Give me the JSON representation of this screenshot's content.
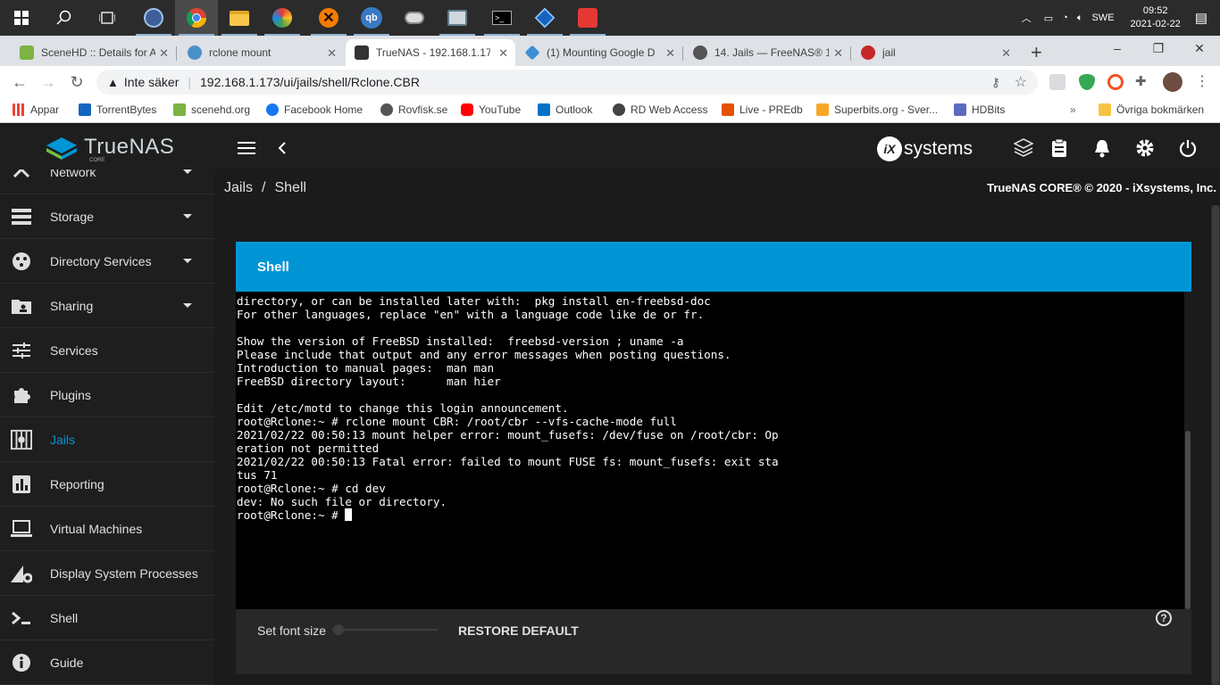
{
  "taskbar": {
    "language": "SWE",
    "time": "09:52",
    "date": "2021-02-22",
    "icons": [
      "windows-start-icon",
      "search-icon",
      "task-view-icon",
      "app-icon",
      "chrome-icon",
      "file-explorer-icon",
      "app-icon",
      "app-icon",
      "qbittorrent-icon",
      "app-icon",
      "app-icon",
      "terminal-icon",
      "app-icon",
      "app-icon"
    ]
  },
  "tabs": [
    {
      "title": "SceneHD :: Details for A",
      "color": "#7cb342"
    },
    {
      "title": "rclone mount",
      "color": "#4a90c8"
    },
    {
      "title": "TrueNAS - 192.168.1.17",
      "color": "#333333"
    },
    {
      "title": "(1) Mounting Google D",
      "color": "#3d8fd6"
    },
    {
      "title": "14. Jails — FreeNAS® 1",
      "color": "#555555"
    },
    {
      "title": "jail",
      "color": "#c62828"
    }
  ],
  "toolbar": {
    "security_label": "Inte säker",
    "url": "192.168.1.173/ui/jails/shell/Rclone.CBR"
  },
  "bookmarks": [
    {
      "label": "Appar",
      "color": "#ea4335"
    },
    {
      "label": "TorrentBytes",
      "color": "#1565c0"
    },
    {
      "label": "scenehd.org",
      "color": "#7cb342"
    },
    {
      "label": "Facebook Home",
      "color": "#1877f2"
    },
    {
      "label": "Rovfisk.se",
      "color": "#555555"
    },
    {
      "label": "YouTube",
      "color": "#ff0000"
    },
    {
      "label": "Outlook",
      "color": "#0072c6"
    },
    {
      "label": "RD Web Access",
      "color": "#444444"
    },
    {
      "label": "Live - PREdb",
      "color": "#e65100"
    },
    {
      "label": "Superbits.org - Sver...",
      "color": "#f9a825"
    },
    {
      "label": "HDBits",
      "color": "#5c6bc0"
    },
    {
      "label": "Övriga bokmärken",
      "color": "#f6c344"
    }
  ],
  "brand": {
    "name": "TrueNAS",
    "sub": "CORE",
    "vendor": "systems",
    "vendor_prefix": "iX"
  },
  "sidebar": {
    "items": [
      {
        "label": "Network",
        "icon": "network-icon",
        "caret": true
      },
      {
        "label": "Storage",
        "icon": "storage-icon",
        "caret": true
      },
      {
        "label": "Directory Services",
        "icon": "directory-services-icon",
        "caret": true
      },
      {
        "label": "Sharing",
        "icon": "sharing-icon",
        "caret": true
      },
      {
        "label": "Services",
        "icon": "services-icon",
        "caret": false
      },
      {
        "label": "Plugins",
        "icon": "plugins-icon",
        "caret": false
      },
      {
        "label": "Jails",
        "icon": "jails-icon",
        "caret": false,
        "active": true
      },
      {
        "label": "Reporting",
        "icon": "reporting-icon",
        "caret": false
      },
      {
        "label": "Virtual Machines",
        "icon": "virtual-machines-icon",
        "caret": false
      },
      {
        "label": "Display System Processes",
        "icon": "processes-icon",
        "caret": false
      },
      {
        "label": "Shell",
        "icon": "shell-icon",
        "caret": false
      },
      {
        "label": "Guide",
        "icon": "guide-icon",
        "caret": false
      }
    ]
  },
  "main": {
    "breadcrumb": [
      "Jails",
      "/",
      "Shell"
    ],
    "copyright": "TrueNAS CORE® © 2020 - iXsystems, Inc.",
    "card_title": "Shell",
    "terminal_lines": [
      "directory, or can be installed later with:  pkg install en-freebsd-doc",
      "For other languages, replace \"en\" with a language code like de or fr.",
      "",
      "Show the version of FreeBSD installed:  freebsd-version ; uname -a",
      "Please include that output and any error messages when posting questions.",
      "Introduction to manual pages:  man man",
      "FreeBSD directory layout:      man hier",
      "",
      "Edit /etc/motd to change this login announcement.",
      "root@Rclone:~ # rclone mount CBR: /root/cbr --vfs-cache-mode full",
      "2021/02/22 00:50:13 mount helper error: mount_fusefs: /dev/fuse on /root/cbr: Op",
      "eration not permitted",
      "2021/02/22 00:50:13 Fatal error: failed to mount FUSE fs: mount_fusefs: exit sta",
      "tus 71",
      "root@Rclone:~ # cd dev",
      "dev: No such file or directory.",
      "root@Rclone:~ # "
    ],
    "font_size_label": "Set font size",
    "restore_label": "RESTORE DEFAULT",
    "help": "?"
  },
  "colors": {
    "accent": "#0095d5",
    "sidebar_bg": "#1e1e1e",
    "terminal_bg": "#000000"
  }
}
